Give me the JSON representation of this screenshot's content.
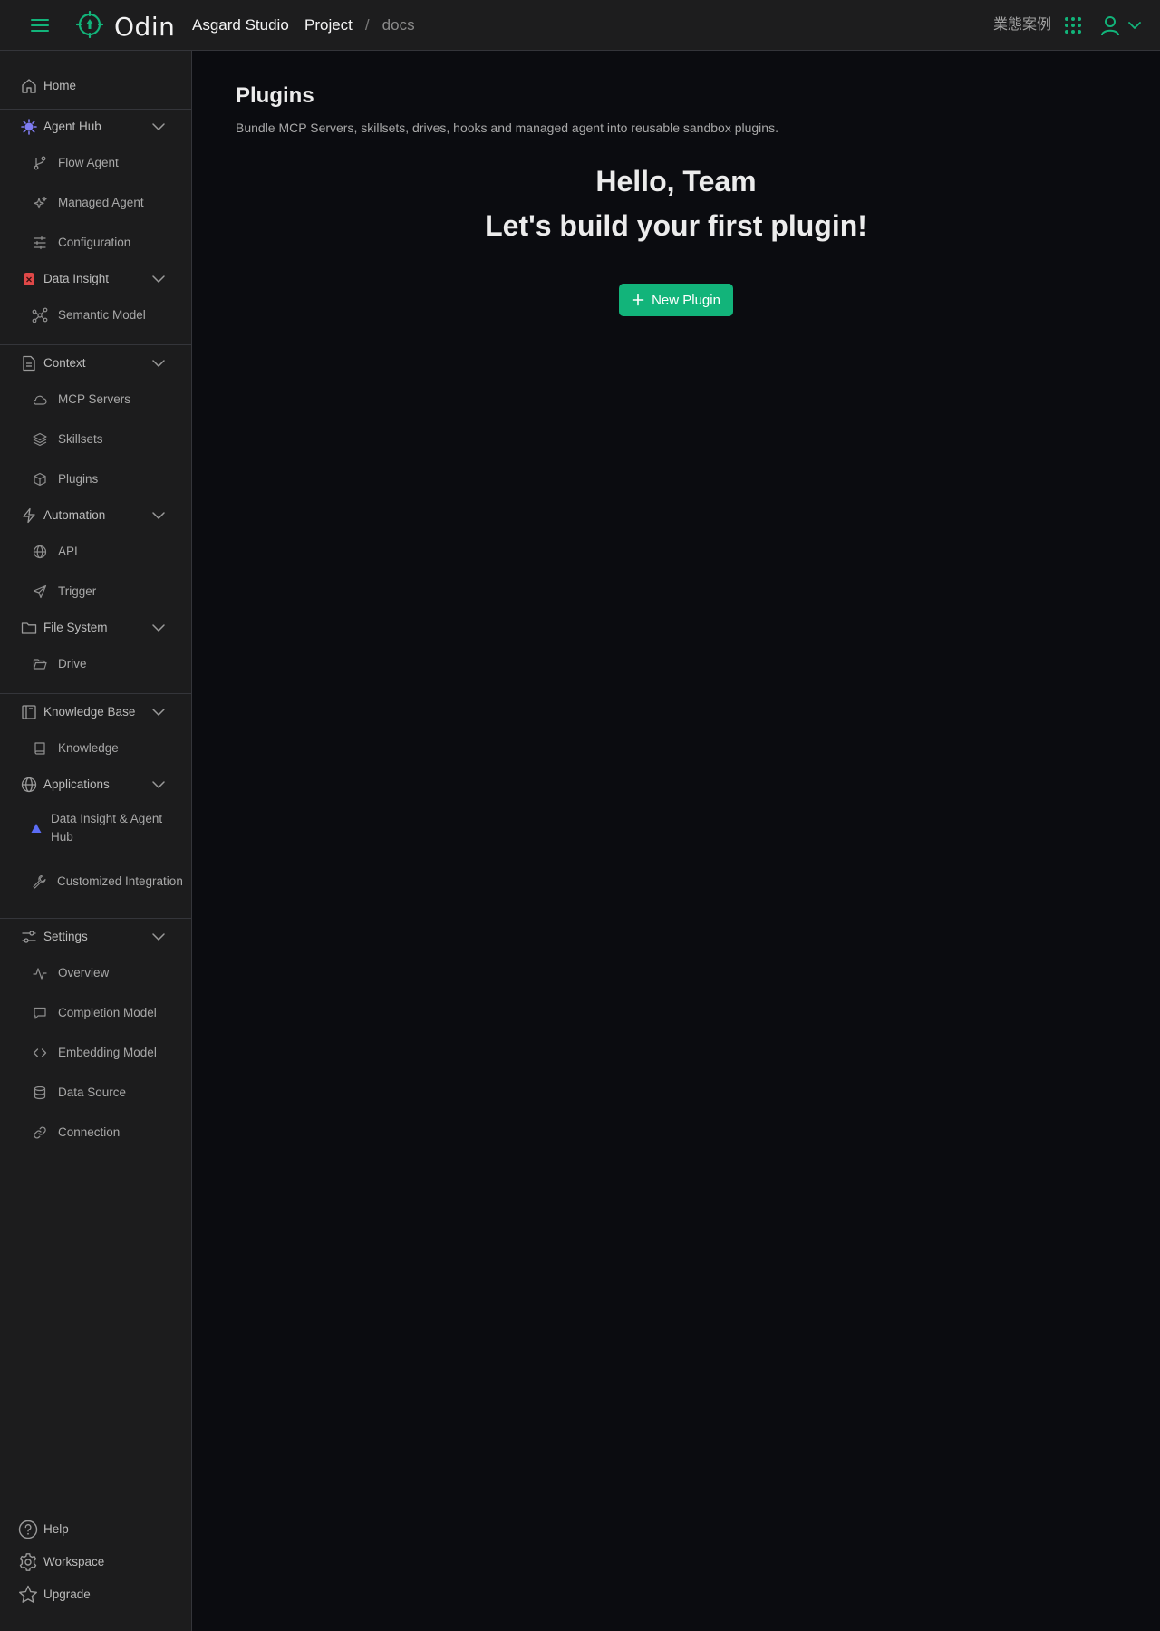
{
  "topbar": {
    "logo_text": "Odin",
    "org": "Asgard Studio",
    "breadcrumb_project": "Project",
    "breadcrumb_sep": "/",
    "breadcrumb_current": "docs",
    "business_cases": "業態案例"
  },
  "sidebar": {
    "home": "Home",
    "agent_hub": "Agent Hub",
    "flow_agent": "Flow Agent",
    "managed_agent": "Managed Agent",
    "configuration": "Configuration",
    "data_insight": "Data Insight",
    "semantic_model": "Semantic Model",
    "context": "Context",
    "mcp_servers": "MCP Servers",
    "skillsets": "Skillsets",
    "plugins": "Plugins",
    "automation": "Automation",
    "api": "API",
    "trigger": "Trigger",
    "file_system": "File System",
    "drive": "Drive",
    "knowledge_base": "Knowledge Base",
    "knowledge": "Knowledge",
    "applications": "Applications",
    "data_insight_agent_hub": "Data Insight & Agent Hub",
    "customized_integration": "Customized Integration",
    "settings": "Settings",
    "overview": "Overview",
    "completion_model": "Completion Model",
    "embedding_model": "Embedding Model",
    "data_source": "Data Source",
    "connection": "Connection",
    "help": "Help",
    "workspace": "Workspace",
    "upgrade": "Upgrade"
  },
  "main": {
    "title": "Plugins",
    "description": "Bundle MCP Servers, skillsets, drives, hooks and managed agent into reusable sandbox plugins.",
    "hello": "Hello, Team",
    "cta_heading": "Let's build your first plugin!",
    "new_plugin_label": "New Plugin"
  },
  "colors": {
    "accent": "#12b47a",
    "background": "#0b0c10",
    "sidebar_bg": "#1c1c1d"
  },
  "icons": {
    "menu": "hamburger-icon",
    "apps": "grid-dots-icon",
    "user": "user-icon"
  }
}
